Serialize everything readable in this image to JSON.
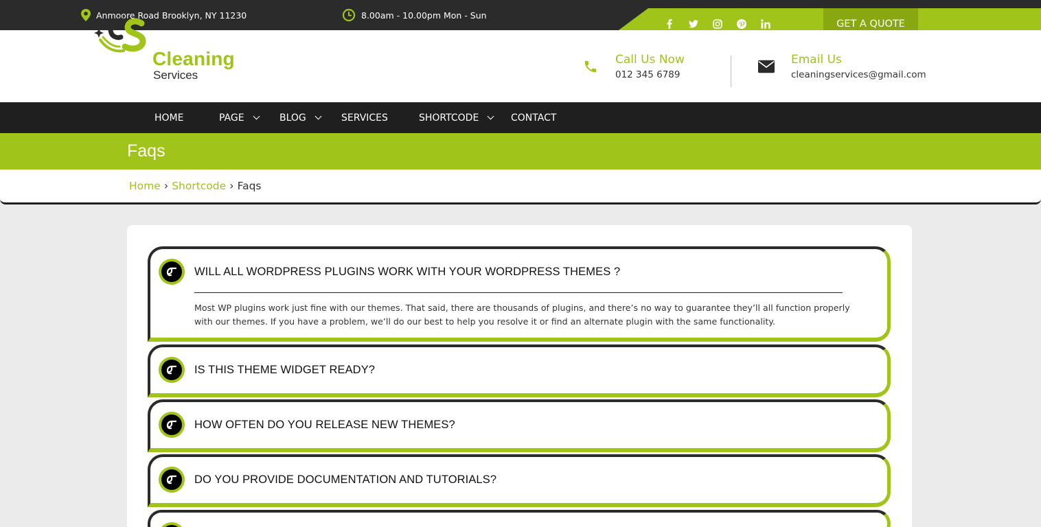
{
  "topbar": {
    "address": "Anmoore Road Brooklyn, NY 11230",
    "hours": "8.00am - 10.00pm Mon - Sun",
    "socials": [
      {
        "icon": "facebook-icon",
        "glyph": "f"
      },
      {
        "icon": "twitter-icon",
        "glyph": "t"
      },
      {
        "icon": "instagram-icon",
        "glyph": "ig"
      },
      {
        "icon": "pinterest-icon",
        "glyph": "p"
      },
      {
        "icon": "linkedin-icon",
        "glyph": "in"
      }
    ],
    "quote_label": "GET A QUOTE"
  },
  "header": {
    "logo_title": "Cleaning",
    "logo_subtitle": "Services",
    "call_label": "Call Us Now",
    "call_value": "012 345 6789",
    "email_label": "Email Us",
    "email_value": "cleaningservices@gmail.com"
  },
  "nav": {
    "home": "HOME",
    "page": "PAGE",
    "blog": "BLOG",
    "services": "SERVICES",
    "shortcode": "SHORTCODE",
    "contact": "CONTACT"
  },
  "page_title": "Faqs",
  "breadcrumb": {
    "home": "Home",
    "shortcode": "Shortcode",
    "current": "Faqs"
  },
  "faqs": [
    {
      "question": "WILL ALL WORDPRESS PLUGINS WORK WITH YOUR WORDPRESS THEMES ?",
      "answer": "Most WP plugins work just fine with our themes. That said, there are thousands of plugins, and there’s no way to guarantee they’ll all function properly with our themes. If you have a problem, we’ll do our best to help you resolve it or find an alternate plugin with the same functionality."
    },
    {
      "question": "IS THIS THEME WIDGET READY?"
    },
    {
      "question": "HOW OFTEN DO YOU RELEASE NEW THEMES?"
    },
    {
      "question": "DO YOU PROVIDE DOCUMENTATION AND TUTORIALS?"
    }
  ],
  "colors": {
    "accent": "#a0c419",
    "accent_dark": "#88a711",
    "dark": "#2b2b2b",
    "nav": "#1f1f1f"
  }
}
